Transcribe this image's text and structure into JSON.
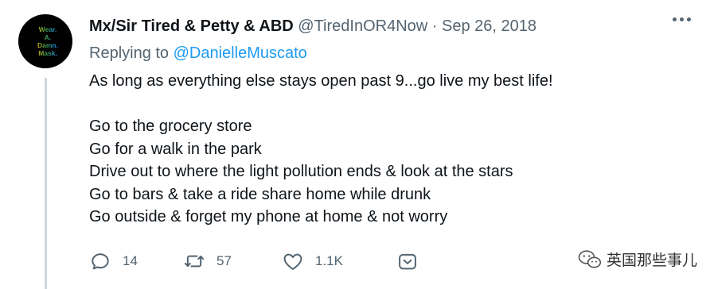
{
  "tweet": {
    "author_name": "Mx/Sir Tired & Petty & ABD",
    "handle": "@TiredInOR4Now",
    "separator": "·",
    "date": "Sep 26, 2018",
    "avatar_text": [
      "Wear.",
      "A.",
      "Damn.",
      "Mask."
    ],
    "replying_label": "Replying to",
    "replying_to": "@DanielleMuscato",
    "body_lines": [
      "As long as everything else stays open past 9...go live my best life!",
      "",
      "Go to the grocery store",
      "Go for a walk in the park",
      "Drive out to where the light pollution ends & look at the stars",
      "Go to bars & take a ride share home while drunk",
      "Go outside & forget my phone at home & not worry"
    ]
  },
  "actions": {
    "reply_count": "14",
    "retweet_count": "57",
    "like_count": "1.1K"
  },
  "watermark": {
    "text": "英国那些事儿",
    "icon": "wechat-icon"
  },
  "colors": {
    "text": "#0f1419",
    "secondary": "#536471",
    "link": "#1d9bf0",
    "thread_line": "#cfd9de"
  }
}
